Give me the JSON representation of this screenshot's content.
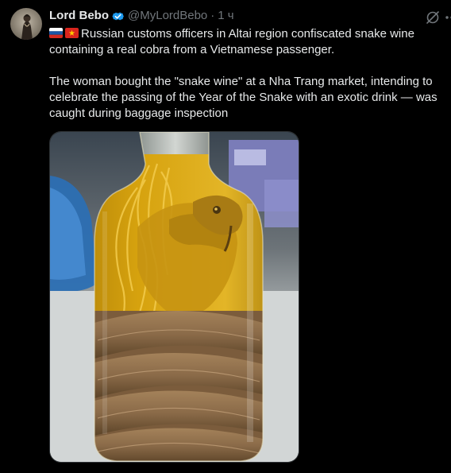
{
  "tweet": {
    "author": {
      "display_name": "Lord Bebo",
      "handle": "@MyLordBebo",
      "verified": true,
      "avatar_icon": "avatar-silhouette"
    },
    "separator": "·",
    "timestamp": "1 ч",
    "flags": [
      "russia-flag",
      "vietnam-flag"
    ],
    "paragraph_1": "Russian customs officers in Altai region confiscated snake wine containing a real cobra from a Vietnamese passenger.",
    "paragraph_2": "The woman bought the \"snake wine\" at a Nha Trang market, intending to celebrate the passing of the Year of the Snake with an exotic drink — was caught during baggage inspection",
    "actions": {
      "grok_icon": "grok-icon",
      "more_icon": "more-options-icon"
    },
    "media": {
      "type": "photo",
      "subject": "bottle-with-cobra",
      "colors": {
        "liquid": "#d6a20e",
        "snake_body": "#8a6a48",
        "background_top": "#3a4550",
        "background_bottom": "#cfd3d3"
      }
    }
  },
  "colors": {
    "background": "#000000",
    "text_primary": "#e7e9ea",
    "text_secondary": "#71767b",
    "verified_blue": "#1d9bf0",
    "border": "#2f3336"
  }
}
